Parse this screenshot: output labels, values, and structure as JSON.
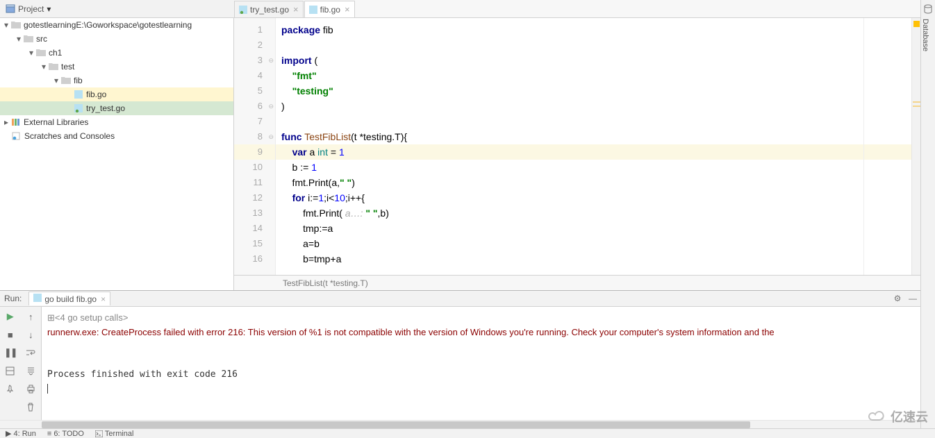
{
  "toolbar": {
    "project_label": "Project"
  },
  "tabs": [
    {
      "label": "try_test.go",
      "active": false,
      "test_overlay": true
    },
    {
      "label": "fib.go",
      "active": true,
      "test_overlay": false
    }
  ],
  "project": {
    "root": "gotestlearning",
    "root_path": "E:\\Goworkspace\\gotestlearning",
    "src": "src",
    "ch1": "ch1",
    "test": "test",
    "fib": "fib",
    "file_fib": "fib.go",
    "file_try": "try_test.go",
    "ext_lib": "External Libraries",
    "scratches": "Scratches and Consoles"
  },
  "code": {
    "lines": [
      "1",
      "2",
      "3",
      "4",
      "5",
      "6",
      "7",
      "8",
      "9",
      "10",
      "11",
      "12",
      "13",
      "14",
      "15",
      "16"
    ],
    "highlight_line": 9,
    "tokens": [
      [
        {
          "c": "kw",
          "t": "package"
        },
        {
          "c": "ident",
          "t": " fib"
        }
      ],
      [],
      [
        {
          "c": "kw",
          "t": "import"
        },
        {
          "c": "ident",
          "t": " ("
        }
      ],
      [
        {
          "c": "ident",
          "t": "    "
        },
        {
          "c": "str",
          "t": "\"fmt\""
        }
      ],
      [
        {
          "c": "ident",
          "t": "    "
        },
        {
          "c": "str",
          "t": "\"testing\""
        }
      ],
      [
        {
          "c": "ident",
          "t": ")"
        }
      ],
      [],
      [
        {
          "c": "kw",
          "t": "func"
        },
        {
          "c": "ident",
          "t": " "
        },
        {
          "c": "funcname",
          "t": "TestFibList"
        },
        {
          "c": "ident",
          "t": "(t *testing.T){"
        }
      ],
      [
        {
          "c": "ident",
          "t": "    "
        },
        {
          "c": "kw",
          "t": "var"
        },
        {
          "c": "ident",
          "t": " a "
        },
        {
          "c": "typ",
          "t": "int"
        },
        {
          "c": "ident",
          "t": " = "
        },
        {
          "c": "num",
          "t": "1"
        }
      ],
      [
        {
          "c": "ident",
          "t": "    b := "
        },
        {
          "c": "num",
          "t": "1"
        }
      ],
      [
        {
          "c": "ident",
          "t": "    fmt.Print(a,"
        },
        {
          "c": "str",
          "t": "\" \""
        },
        {
          "c": "ident",
          "t": ")"
        }
      ],
      [
        {
          "c": "ident",
          "t": "    "
        },
        {
          "c": "kw",
          "t": "for"
        },
        {
          "c": "ident",
          "t": " i:="
        },
        {
          "c": "num",
          "t": "1"
        },
        {
          "c": "ident",
          "t": ";i<"
        },
        {
          "c": "num",
          "t": "10"
        },
        {
          "c": "ident",
          "t": ";i++{"
        }
      ],
      [
        {
          "c": "ident",
          "t": "        fmt.Print( "
        },
        {
          "c": "hint",
          "t": "a…: "
        },
        {
          "c": "str",
          "t": "\" \""
        },
        {
          "c": "ident",
          "t": ",b)"
        }
      ],
      [
        {
          "c": "ident",
          "t": "        tmp:=a"
        }
      ],
      [
        {
          "c": "ident",
          "t": "        a=b"
        }
      ],
      [
        {
          "c": "ident",
          "t": "        b=tmp+a"
        }
      ]
    ]
  },
  "breadcrumb": "TestFibList(t *testing.T)",
  "right_rail": {
    "label": "Database"
  },
  "run": {
    "label": "Run:",
    "tab": "go build fib.go",
    "fold_text": "4 go setup calls",
    "error_line": "runnerw.exe: CreateProcess failed with error 216: This version of %1 is not compatible with the version of Windows you're running. Check your computer's system information and the",
    "exit_line": "Process finished with exit code 216"
  },
  "status": {
    "run_btn": "4: Run",
    "todo_btn": "6: TODO",
    "terminal_btn": "Terminal"
  },
  "watermark": "亿速云"
}
